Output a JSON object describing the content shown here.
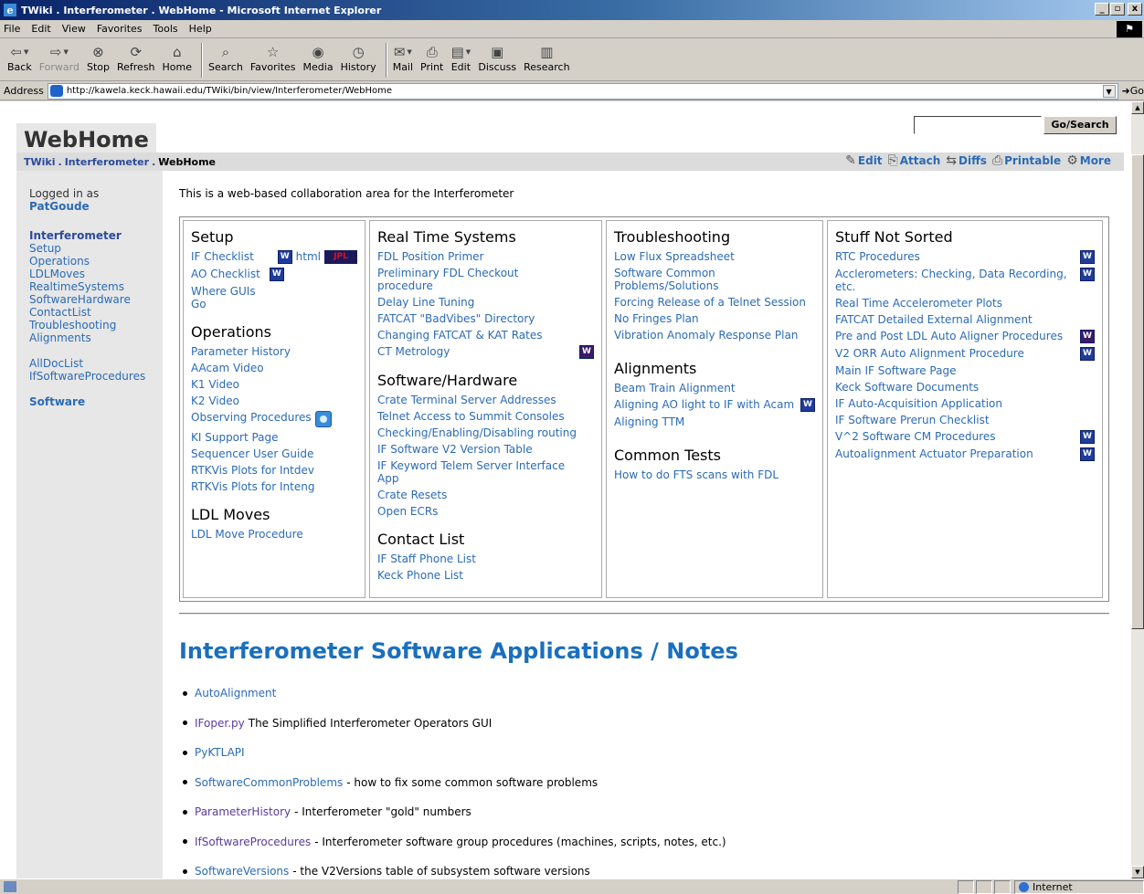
{
  "window": {
    "title": "TWiki . Interferometer . WebHome - Microsoft Internet Explorer"
  },
  "menu": [
    "File",
    "Edit",
    "View",
    "Favorites",
    "Tools",
    "Help"
  ],
  "toolbar": {
    "back": "Back",
    "forward": "Forward",
    "stop": "Stop",
    "refresh": "Refresh",
    "home": "Home",
    "search": "Search",
    "favorites": "Favorites",
    "media": "Media",
    "history": "History",
    "mail": "Mail",
    "print": "Print",
    "edit": "Edit",
    "discuss": "Discuss",
    "research": "Research"
  },
  "address": {
    "label": "Address",
    "url": "http://kawela.keck.hawaii.edu/TWiki/bin/view/Interferometer/WebHome",
    "go": "Go"
  },
  "status": {
    "zone": "Internet"
  },
  "page": {
    "search_button": "Go/Search",
    "title": "WebHome",
    "breadcrumb": {
      "root": "TWiki",
      "web": "Interferometer",
      "sep": ".",
      "current": "WebHome"
    },
    "actions": {
      "edit": "Edit",
      "attach": "Attach",
      "diffs": "Diffs",
      "printable": "Printable",
      "more": "More"
    },
    "sidebar": {
      "logged_in": "Logged in as",
      "user": "PatGoude",
      "web": "Interferometer",
      "links": [
        "Setup",
        "Operations",
        "LDLMoves",
        "RealtimeSystems",
        "SoftwareHardware",
        "ContactList",
        "Troubleshooting",
        "Alignments"
      ],
      "links2": [
        "AllDocList",
        "IfSoftwareProcedures"
      ],
      "software": "Software"
    },
    "intro": "This is a web-based collaboration area for the Interferometer",
    "columns": {
      "setup": {
        "h1": "Setup",
        "if_checklist": "IF Checklist",
        "html": "html",
        "jpl": "JPL",
        "ao_checklist": "AO Checklist",
        "where_guis": "Where GUIs Go",
        "h2": "Operations",
        "ops": [
          "Parameter History",
          "AAcam Video",
          "K1 Video",
          "K2 Video"
        ],
        "observing": "Observing Procedures",
        "ops2": [
          "KI Support Page",
          "Sequencer User Guide",
          "RTKVis Plots for Intdev",
          "RTKVis Plots for Inteng"
        ],
        "h3": "LDL Moves",
        "ldl": "LDL Move Procedure"
      },
      "rts": {
        "h1": "Real Time Systems",
        "links": [
          "FDL Position Primer",
          "Preliminary FDL Checkout procedure",
          "Delay Line Tuning",
          "FATCAT \"BadVibes\" Directory",
          "Changing FATCAT & KAT Rates"
        ],
        "ct": "CT Metrology",
        "h2": "Software/Hardware",
        "sw": [
          "Crate Terminal Server Addresses",
          "Telnet Access to Summit Consoles",
          "Checking/Enabling/Disabling routing",
          "IF Software V2 Version Table",
          "IF Keyword Telem Server Interface App",
          "Crate Resets",
          "Open ECRs"
        ],
        "h3": "Contact List",
        "contacts": [
          "IF Staff Phone List",
          "Keck Phone List"
        ]
      },
      "trouble": {
        "h1": "Troubleshooting",
        "links": [
          "Low Flux Spreadsheet",
          "Software Common Problems/Solutions",
          "Forcing Release of a Telnet Session",
          "No Fringes Plan",
          "Vibration Anomaly Response Plan"
        ],
        "h2": "Alignments",
        "beam": "Beam Train Alignment",
        "aligning_ao": "Aligning AO light to IF with Acam",
        "ttm": "Aligning TTM",
        "h3": "Common Tests",
        "fts": "How to do FTS scans with FDL"
      },
      "unsorted": {
        "h1": "Stuff Not Sorted",
        "links": [
          {
            "t": "RTC Procedures",
            "w": true
          },
          {
            "t": "Acclerometers: Checking, Data Recording, etc.",
            "w": true
          },
          {
            "t": "Real Time Accelerometer Plots",
            "w": false
          },
          {
            "t": "FATCAT Detailed External Alignment",
            "w": false
          },
          {
            "t": "Pre and Post LDL Auto Aligner Procedures",
            "w": true
          },
          {
            "t": "V2 ORR Auto Alignment Procedure",
            "w": true
          },
          {
            "t": "Main IF Software Page",
            "w": false
          },
          {
            "t": "Keck Software Documents",
            "w": false
          },
          {
            "t": "IF Auto-Acquisition Application",
            "w": false
          },
          {
            "t": "IF Software Prerun Checklist",
            "w": false
          },
          {
            "t": "V^2 Software CM Procedures",
            "w": true
          },
          {
            "t": "Autoalignment Actuator Preparation",
            "w": true
          }
        ]
      }
    },
    "apps_title": "Interferometer Software Applications / Notes",
    "notes": [
      {
        "link": "AutoAlignment",
        "desc": ""
      },
      {
        "link": "IFoper.py",
        "desc": "The Simplified Interferometer Operators GUI"
      },
      {
        "link": "PyKTLAPI",
        "desc": ""
      },
      {
        "link": "SoftwareCommonProblems",
        "desc": "- how to fix some common software problems"
      },
      {
        "link": "ParameterHistory",
        "desc": "- Interferometer \"gold\" numbers"
      },
      {
        "link": "IfSoftwareProcedures",
        "desc": "- Interferometer software group procedures (machines, scripts, notes, etc.)"
      },
      {
        "link": "SoftwareVersions",
        "desc": "- the V2Versions table of subsystem software versions"
      }
    ]
  }
}
